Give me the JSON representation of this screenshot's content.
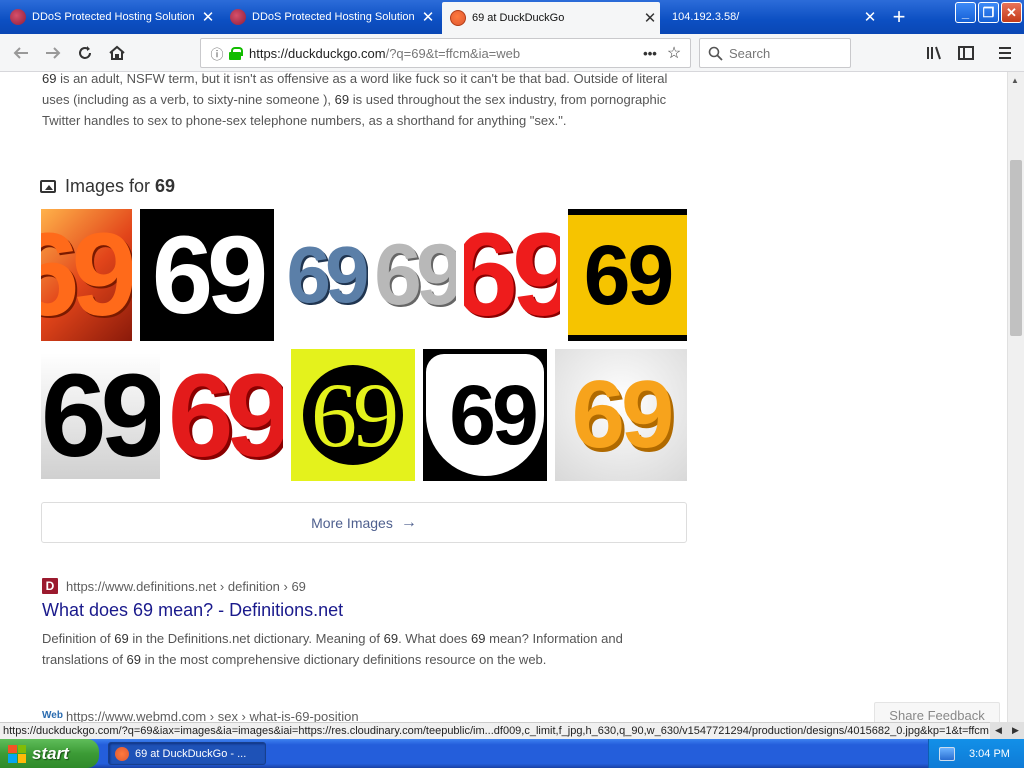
{
  "tabs": [
    {
      "title": "DDoS Protected Hosting Solution",
      "active": false
    },
    {
      "title": "DDoS Protected Hosting Solution",
      "active": false
    },
    {
      "title": "69 at DuckDuckGo",
      "active": true
    },
    {
      "title": "104.192.3.58/",
      "active": false
    }
  ],
  "newtab_label": "+",
  "window_buttons": {
    "minimize": "_",
    "restore": "❐",
    "close": "✕"
  },
  "nav": {
    "url_host": "https://duckduckgo.com",
    "url_rest": "/?q=69&t=ffcm&ia=web",
    "search_placeholder": "Search",
    "icons": {
      "back": "arrow-left",
      "forward": "arrow-right",
      "reload": "reload",
      "home": "home",
      "library": "library",
      "sidebar": "sidebar",
      "menu": "hamburger"
    }
  },
  "snippet": {
    "p1": "69",
    "p2": " is an adult, NSFW term, but it isn't as offensive as a word like fuck so it can't be that bad. Outside of literal uses (including as a verb, to sixty-nine someone ), ",
    "p3": "69",
    "p4": " is used throughout the sex industry, from pornographic Twitter handles to sex to phone-sex telephone numbers, as a shorthand for anything \"sex.\"."
  },
  "images": {
    "heading_prefix": "Images for",
    "query": "69",
    "thumbs": [
      "69",
      "69",
      "69",
      "69",
      "69",
      "69",
      "69",
      "69",
      "69",
      "69",
      "69"
    ],
    "more_label": "More Images"
  },
  "result1": {
    "favicon_letter": "D",
    "url_domain": "https://www.definitions.net",
    "url_path": " › definition › 69",
    "title": "What does 69 mean? - Definitions.net",
    "s1": "Definition of ",
    "s2": "69",
    "s3": " in the Definitions.net dictionary. Meaning of ",
    "s4": "69",
    "s5": ". What does ",
    "s6": "69",
    "s7": " mean? Information and translations of ",
    "s8": "69",
    "s9": " in the most comprehensive dictionary definitions resource on the web."
  },
  "result2": {
    "favicon_text": "Web",
    "url": "https://www.webmd.com › sex › what-is-69-position"
  },
  "feedback_label": "Share Feedback",
  "statusbar_text": "https://duckduckgo.com/?q=69&iax=images&ia=images&iai=https://res.cloudinary.com/teepublic/im...df009,c_limit,f_jpg,h_630,q_90,w_630/v1547721294/production/designs/4015682_0.jpg&kp=1&t=ffcm",
  "taskbar": {
    "start_label": "start",
    "task_item": "69 at DuckDuckGo - ...",
    "clock": "3:04 PM"
  }
}
